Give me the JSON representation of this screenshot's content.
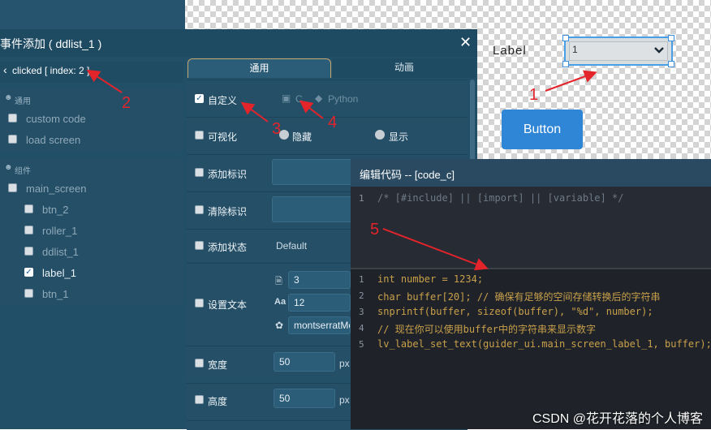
{
  "canvas": {
    "label_text": "Label",
    "dropdown_value": "1",
    "button_text": "Button"
  },
  "dialog": {
    "title": "事件添加 ( ddlist_1 )",
    "breadcrumb": "clicked [ index: 2 ]",
    "groups": [
      {
        "header": "通用",
        "items": [
          {
            "label": "custom code",
            "checked": false
          },
          {
            "label": "load screen",
            "checked": false
          }
        ]
      },
      {
        "header": "组件",
        "items": [
          {
            "label": "main_screen",
            "checked": false
          },
          {
            "label": "btn_2",
            "checked": false
          },
          {
            "label": "roller_1",
            "checked": false
          },
          {
            "label": "ddlist_1",
            "checked": false
          },
          {
            "label": "label_1",
            "checked": true
          },
          {
            "label": "btn_1",
            "checked": false
          }
        ]
      }
    ],
    "tabs": [
      "通用",
      "动画"
    ],
    "props": {
      "custom": "自定义",
      "lang_c": "C",
      "lang_py": "Python",
      "visual": "可视化",
      "hide": "隐藏",
      "show": "显示",
      "add_flag": "添加标识",
      "clear_flag": "清除标识",
      "add_state": "添加状态",
      "state_value": "Default",
      "set_text": "设置文本",
      "text_value": "3",
      "font_size": "12",
      "font_name": "montserratMe",
      "width": "宽度",
      "width_value": "50",
      "height": "高度",
      "height_value": "50",
      "unit": "px"
    }
  },
  "editor": {
    "title": "编辑代码 -- [code_c]",
    "header_lines": [
      {
        "n": "1",
        "text": "/* [#include] || [import] || [variable] */"
      }
    ],
    "lines": [
      {
        "n": "1",
        "text": "int number = 1234;"
      },
      {
        "n": "2",
        "text": "char buffer[20]; // 确保有足够的空间存储转换后的字符串"
      },
      {
        "n": "3",
        "text": "snprintf(buffer, sizeof(buffer), \"%d\", number);"
      },
      {
        "n": "4",
        "text": "// 现在你可以使用buffer中的字符串来显示数字"
      },
      {
        "n": "5",
        "text": "lv_label_set_text(guider_ui.main_screen_label_1, buffer);"
      }
    ]
  },
  "annotations": [
    "1",
    "2",
    "3",
    "4",
    "5"
  ],
  "watermark": "CSDN @花开花落的个人博客",
  "colors": {
    "accent": "#2f86d6",
    "annotation": "#e3242b",
    "dialog_bg": "#1e4a62"
  }
}
